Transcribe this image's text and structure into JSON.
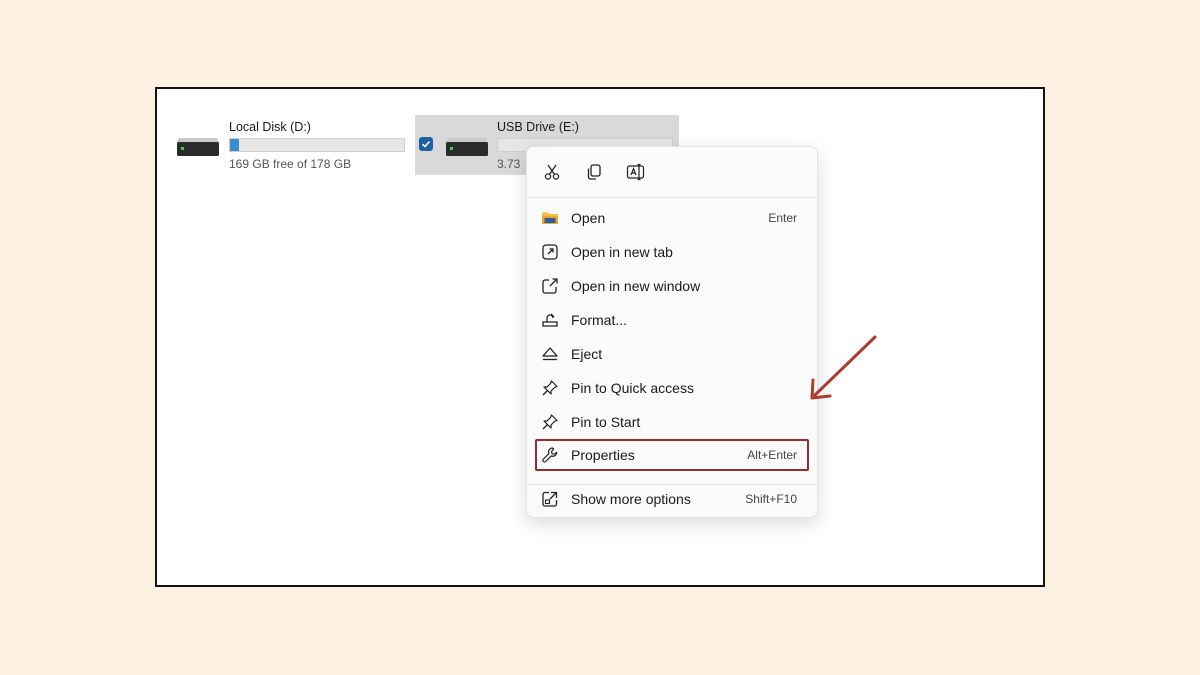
{
  "drives": [
    {
      "name": "Local Disk (D:)",
      "free_text": "169 GB free of 178 GB",
      "used_fraction": 0.05,
      "selected": false
    },
    {
      "name": "USB Drive (E:)",
      "free_text": "3.73",
      "used_fraction": 0.0,
      "selected": true
    }
  ],
  "quick_actions": [
    {
      "icon": "cut-icon"
    },
    {
      "icon": "copy-icon"
    },
    {
      "icon": "rename-icon"
    }
  ],
  "menu": {
    "items": [
      {
        "label": "Open",
        "shortcut": "Enter",
        "icon": "folder-icon"
      },
      {
        "label": "Open in new tab",
        "shortcut": "",
        "icon": "open-new-tab-icon"
      },
      {
        "label": "Open in new window",
        "shortcut": "",
        "icon": "open-new-window-icon"
      },
      {
        "label": "Format...",
        "shortcut": "",
        "icon": "format-icon"
      },
      {
        "label": "Eject",
        "shortcut": "",
        "icon": "eject-icon"
      },
      {
        "label": "Pin to Quick access",
        "shortcut": "",
        "icon": "pin-icon"
      },
      {
        "label": "Pin to Start",
        "shortcut": "",
        "icon": "pin-icon"
      },
      {
        "label": "Properties",
        "shortcut": "Alt+Enter",
        "icon": "wrench-icon",
        "highlighted": true
      },
      {
        "label": "Show more options",
        "shortcut": "Shift+F10",
        "icon": "more-options-icon"
      }
    ]
  },
  "colors": {
    "background": "#fdf1e1",
    "highlight_border": "#9c2b2b",
    "annotation_arrow": "#b03a2e",
    "usage_bar": "#3b8ed6",
    "checkbox": "#1f5fa8"
  }
}
